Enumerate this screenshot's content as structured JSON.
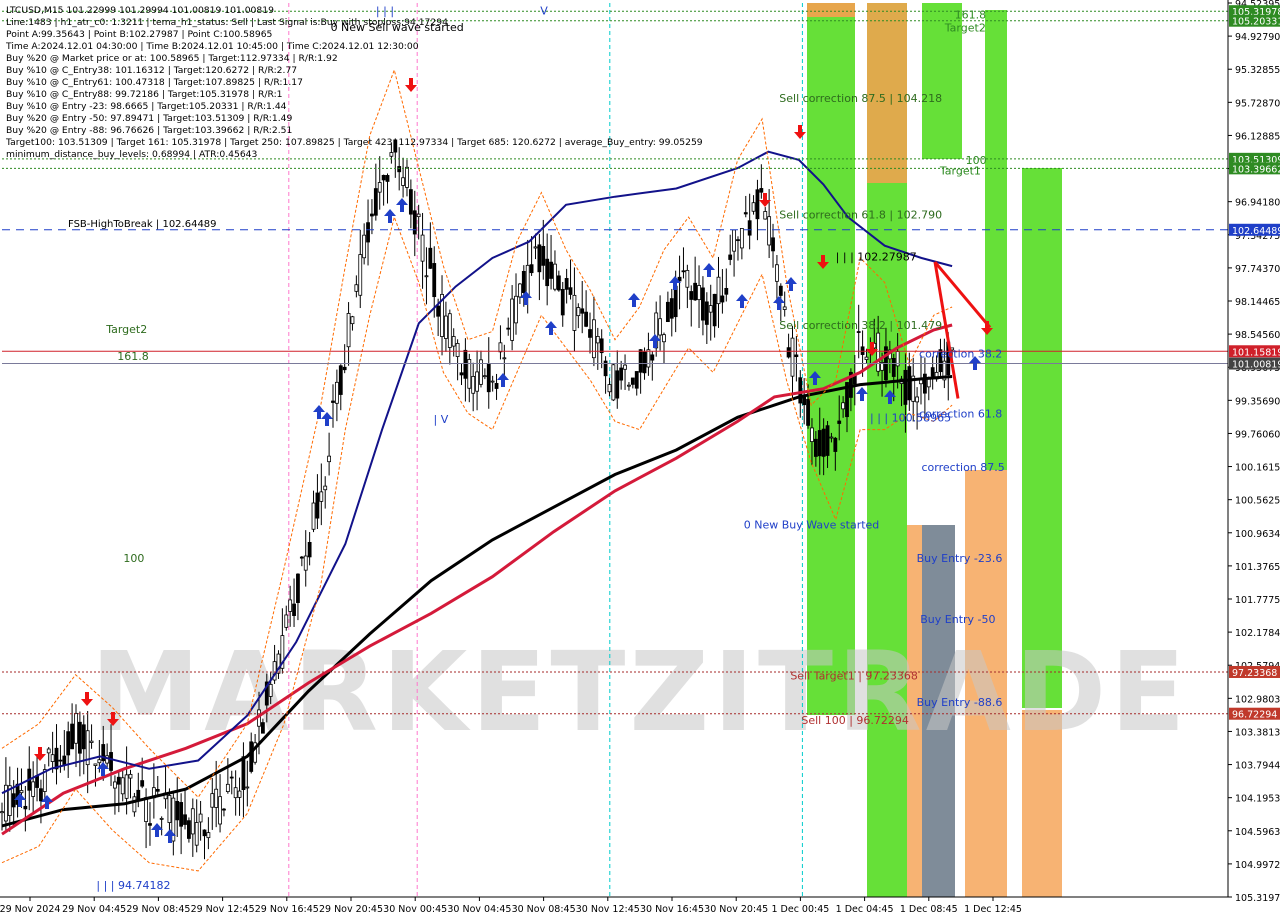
{
  "header": {
    "lines": [
      "LTCUSD,M15  101.22999 101.29994 101.00819 101.00819",
      "Line:1483 | h1_atr_c0: 1.3211 | tema_h1_status: Sell | Last Signal is:Buy with stoploss:94.17294",
      "Point A:99.35643 | Point B:102.27987 | Point C:100.58965",
      "Time A:2024.12.01 04:30:00 | Time B:2024.12.01 10:45:00 | Time C:2024.12.01 12:30:00",
      "Buy %20 @ Market price or at: 100.58965 | Target:112.97334 | R/R:1.92",
      "Buy %10 @ C_Entry38: 101.16312 | Target:120.6272 | R/R:2.77",
      "Buy %10 @ C_Entry61: 100.47318 | Target:107.89825 | R/R:1.17",
      "Buy %10 @ C_Entry88: 99.72186 | Target:105.31978 | R/R:1",
      "Buy %10 @ Entry -23: 98.6665 | Target:105.20331 | R/R:1.44",
      "Buy %20 @ Entry -50: 97.89471 | Target:103.51309 | R/R:1.49",
      "Buy %20 @ Entry -88: 96.76626 | Target:103.39662 | R/R:2.51",
      "Target100: 103.51309 | Target 161: 105.31978 | Target 250: 107.89825 | Target 423: 112.97334 | Target 685: 120.6272 | average_Buy_entry: 99.05259",
      "minimum_distance_buy_levels: 0.68994 | ATR:0.45643"
    ]
  },
  "chart_data": {
    "type": "candlestick",
    "symbol": "LTCUSD",
    "timeframe": "M15",
    "ylim": [
      94.48,
      105.42
    ],
    "x_ticks": [
      "29 Nov 2024",
      "29 Nov 04:45",
      "29 Nov 08:45",
      "29 Nov 12:45",
      "29 Nov 16:45",
      "29 Nov 20:45",
      "30 Nov 00:45",
      "30 Nov 04:45",
      "30 Nov 08:45",
      "30 Nov 12:45",
      "30 Nov 16:45",
      "30 Nov 20:45",
      "1 Dec 00:45",
      "1 Dec 04:45",
      "1 Dec 08:45",
      "1 Dec 12:45"
    ],
    "y_ticks": [
      "94.52395",
      "94.92790",
      "95.32855",
      "95.72870",
      "96.12885",
      "96.52870",
      "96.94180",
      "97.34275",
      "97.74370",
      "98.14465",
      "98.54560",
      "98.95075",
      "99.35690",
      "99.76060",
      "100.16155",
      "100.56250",
      "100.96345",
      "101.37655",
      "101.77750",
      "102.17845",
      "102.57940",
      "102.98035",
      "103.38130",
      "103.79440",
      "104.19535",
      "104.59630",
      "104.99725",
      "105.31978"
    ],
    "price_labels": [
      {
        "text": "105.31978",
        "value": 105.31978,
        "color": "#2e8b22"
      },
      {
        "text": "105.20331",
        "value": 105.20331,
        "color": "#2e8b22"
      },
      {
        "text": "103.51309",
        "value": 103.51309,
        "color": "#2e8b22"
      },
      {
        "text": "103.39662",
        "value": 103.39662,
        "color": "#2e8b22"
      },
      {
        "text": "102.64489",
        "value": 102.64489,
        "color": "#1f3fc8"
      },
      {
        "text": "101.15819",
        "value": 101.15819,
        "color": "#d0202a"
      },
      {
        "text": "101.00819",
        "value": 101.00819,
        "color": "#444444"
      },
      {
        "text": "97.23368",
        "value": 97.23368,
        "color": "#c0392b"
      },
      {
        "text": "96.72294",
        "value": 96.72294,
        "color": "#c0392b"
      }
    ],
    "hlines": [
      {
        "value": 102.64489,
        "color": "#1f3fc8",
        "dash": "8,6",
        "label": "FSB-HighToBreak | 102.64489"
      },
      {
        "value": 101.15819,
        "color": "#d0202a",
        "dash": "",
        "label": ""
      },
      {
        "value": 101.00819,
        "color": "#7a7a9a",
        "dash": "",
        "label": ""
      },
      {
        "value": 103.51309,
        "color": "#2e8b22",
        "dash": "2,2",
        "label": ""
      },
      {
        "value": 103.39662,
        "color": "#2e8b22",
        "dash": "2,2",
        "label": ""
      },
      {
        "value": 105.20331,
        "color": "#2e8b22",
        "dash": "2,2",
        "label": ""
      },
      {
        "value": 105.31978,
        "color": "#2e8b22",
        "dash": "2,2",
        "label": ""
      },
      {
        "value": 97.23368,
        "color": "#a52a2a",
        "dash": "2,2",
        "label": ""
      },
      {
        "value": 96.72294,
        "color": "#a52a2a",
        "dash": "2,2",
        "label": ""
      }
    ],
    "vlines": [
      {
        "tick": 6,
        "color": "#ff77cc"
      },
      {
        "tick": 4,
        "color": "#ff77cc"
      },
      {
        "tick": 9,
        "color": "#00cccc"
      },
      {
        "tick": 12,
        "color": "#00cccc"
      }
    ],
    "annotations": [
      {
        "text": "0 New Sell wave started",
        "value": 105.08,
        "xpos": 0.268,
        "color": "#000000"
      },
      {
        "text": "0 New Buy Wave started",
        "value": 98.99,
        "xpos": 0.605,
        "color": "#1f3fc8"
      },
      {
        "text": "Target2",
        "value": 101.38,
        "xpos": 0.085,
        "color": "#2e6b1e"
      },
      {
        "text": "161.8",
        "value": 101.05,
        "xpos": 0.094,
        "color": "#2e6b1e"
      },
      {
        "text": "100",
        "value": 98.58,
        "xpos": 0.099,
        "color": "#2e6b1e"
      },
      {
        "text": "Sell correction 87.5 | 104.218",
        "value": 104.21,
        "xpos": 0.634,
        "color": "#2e6b1e"
      },
      {
        "text": "Sell correction 61.8 | 102.790",
        "value": 102.78,
        "xpos": 0.634,
        "color": "#2e6b1e"
      },
      {
        "text": "Sell correction 38.2 | 101.479",
        "value": 101.43,
        "xpos": 0.634,
        "color": "#2e6b1e"
      },
      {
        "text": "| | | 102.27987",
        "value": 102.27,
        "xpos": 0.68,
        "color": "#000000"
      },
      {
        "text": "| | | 100.58965",
        "value": 100.3,
        "xpos": 0.708,
        "color": "#1f3fc8"
      },
      {
        "text": "correction 38.2",
        "value": 101.08,
        "xpos": 0.748,
        "color": "#1f3fc8"
      },
      {
        "text": "correction 61.8",
        "value": 100.35,
        "xpos": 0.748,
        "color": "#1f3fc8"
      },
      {
        "text": "correction 87.5",
        "value": 99.69,
        "xpos": 0.75,
        "color": "#1f3fc8"
      },
      {
        "text": "Buy Entry -23.6",
        "value": 98.58,
        "xpos": 0.746,
        "color": "#1f3fc8"
      },
      {
        "text": "Buy Entry -50",
        "value": 97.83,
        "xpos": 0.749,
        "color": "#1f3fc8"
      },
      {
        "text": "Buy Entry -88.6",
        "value": 96.82,
        "xpos": 0.746,
        "color": "#1f3fc8"
      },
      {
        "text": "Sell Target1 | 97.23368",
        "value": 97.14,
        "xpos": 0.643,
        "color": "#b03030"
      },
      {
        "text": "Sell 100 | 96.72294",
        "value": 96.6,
        "xpos": 0.652,
        "color": "#b03030"
      },
      {
        "text": "Target2",
        "value": 105.07,
        "xpos": 0.769,
        "color": "#2e8b22"
      },
      {
        "text": "161.8",
        "value": 105.23,
        "xpos": 0.777,
        "color": "#2e8b22"
      },
      {
        "text": "Target1",
        "value": 103.32,
        "xpos": 0.765,
        "color": "#2e8b22"
      },
      {
        "text": "100",
        "value": 103.45,
        "xpos": 0.786,
        "color": "#2e8b22"
      },
      {
        "text": "| | | 94.74182",
        "value": 94.58,
        "xpos": 0.077,
        "color": "#1f3fc8"
      },
      {
        "text": "| | |",
        "value": 105.28,
        "xpos": 0.305,
        "color": "#1f3fc8"
      },
      {
        "text": "| V",
        "value": 100.28,
        "xpos": 0.352,
        "color": "#1f3fc8"
      },
      {
        "text": "V",
        "value": 105.28,
        "xpos": 0.439,
        "color": "#1f3fc8"
      }
    ],
    "watermark": "MARKETZITRADE",
    "series": [
      {
        "name": "",
        "color": "#000000",
        "width": 3,
        "points": [
          [
            0.0,
            95.35
          ],
          [
            0.05,
            95.55
          ],
          [
            0.1,
            95.62
          ],
          [
            0.15,
            95.8
          ],
          [
            0.2,
            96.2
          ],
          [
            0.25,
            97.0
          ],
          [
            0.3,
            97.7
          ],
          [
            0.35,
            98.35
          ],
          [
            0.4,
            98.85
          ],
          [
            0.45,
            99.25
          ],
          [
            0.5,
            99.65
          ],
          [
            0.55,
            99.95
          ],
          [
            0.6,
            100.35
          ],
          [
            0.65,
            100.6
          ],
          [
            0.7,
            100.75
          ],
          [
            0.75,
            100.82
          ],
          [
            0.775,
            100.85
          ]
        ]
      },
      {
        "name": "",
        "color": "#d41a3a",
        "width": 3,
        "points": [
          [
            0.0,
            95.25
          ],
          [
            0.05,
            95.75
          ],
          [
            0.1,
            96.05
          ],
          [
            0.15,
            96.3
          ],
          [
            0.2,
            96.6
          ],
          [
            0.25,
            97.1
          ],
          [
            0.3,
            97.55
          ],
          [
            0.35,
            97.95
          ],
          [
            0.4,
            98.4
          ],
          [
            0.45,
            98.95
          ],
          [
            0.5,
            99.45
          ],
          [
            0.55,
            99.85
          ],
          [
            0.6,
            100.3
          ],
          [
            0.63,
            100.6
          ],
          [
            0.67,
            100.7
          ],
          [
            0.7,
            100.9
          ],
          [
            0.73,
            101.2
          ],
          [
            0.76,
            101.42
          ],
          [
            0.775,
            101.48
          ]
        ]
      },
      {
        "name": "",
        "color": "#12128a",
        "width": 2,
        "points": [
          [
            0.0,
            95.75
          ],
          [
            0.04,
            96.05
          ],
          [
            0.08,
            96.2
          ],
          [
            0.12,
            96.05
          ],
          [
            0.16,
            96.15
          ],
          [
            0.2,
            96.7
          ],
          [
            0.24,
            97.6
          ],
          [
            0.28,
            98.8
          ],
          [
            0.31,
            100.2
          ],
          [
            0.34,
            101.5
          ],
          [
            0.37,
            101.95
          ],
          [
            0.4,
            102.3
          ],
          [
            0.43,
            102.5
          ],
          [
            0.46,
            102.95
          ],
          [
            0.5,
            103.05
          ],
          [
            0.55,
            103.15
          ],
          [
            0.6,
            103.4
          ],
          [
            0.625,
            103.6
          ],
          [
            0.65,
            103.5
          ],
          [
            0.67,
            103.2
          ],
          [
            0.69,
            102.8
          ],
          [
            0.72,
            102.45
          ],
          [
            0.75,
            102.3
          ],
          [
            0.775,
            102.2
          ]
        ]
      },
      {
        "name": "",
        "color": "#ff6a00",
        "width": 1,
        "dash": "3,2",
        "points": [
          [
            0.0,
            96.3
          ],
          [
            0.03,
            96.6
          ],
          [
            0.06,
            97.2
          ],
          [
            0.09,
            96.8
          ],
          [
            0.12,
            96.3
          ],
          [
            0.16,
            95.7
          ],
          [
            0.2,
            96.6
          ],
          [
            0.23,
            98.5
          ],
          [
            0.26,
            100.5
          ],
          [
            0.28,
            102.2
          ],
          [
            0.3,
            103.8
          ],
          [
            0.32,
            104.6
          ],
          [
            0.34,
            103.4
          ],
          [
            0.36,
            102.2
          ],
          [
            0.38,
            101.3
          ],
          [
            0.4,
            101.4
          ],
          [
            0.42,
            102.5
          ],
          [
            0.44,
            103.1
          ],
          [
            0.46,
            102.4
          ],
          [
            0.48,
            101.9
          ],
          [
            0.5,
            101.3
          ],
          [
            0.52,
            101.7
          ],
          [
            0.54,
            102.4
          ],
          [
            0.56,
            102.8
          ],
          [
            0.58,
            102.3
          ],
          [
            0.6,
            103.5
          ],
          [
            0.62,
            104.0
          ],
          [
            0.64,
            102.0
          ],
          [
            0.66,
            100.5
          ],
          [
            0.68,
            100.8
          ],
          [
            0.7,
            102.3
          ],
          [
            0.72,
            102.0
          ],
          [
            0.74,
            101.0
          ],
          [
            0.76,
            101.6
          ],
          [
            0.775,
            101.7
          ]
        ]
      },
      {
        "name": "",
        "color": "#ff6a00",
        "width": 1,
        "dash": "3,2",
        "points": [
          [
            0.0,
            94.9
          ],
          [
            0.03,
            95.1
          ],
          [
            0.06,
            95.8
          ],
          [
            0.09,
            95.3
          ],
          [
            0.12,
            94.9
          ],
          [
            0.16,
            94.8
          ],
          [
            0.2,
            95.5
          ],
          [
            0.23,
            96.6
          ],
          [
            0.26,
            98.3
          ],
          [
            0.28,
            100.2
          ],
          [
            0.3,
            101.6
          ],
          [
            0.32,
            102.8
          ],
          [
            0.34,
            102.0
          ],
          [
            0.36,
            100.9
          ],
          [
            0.38,
            100.4
          ],
          [
            0.4,
            100.2
          ],
          [
            0.42,
            100.9
          ],
          [
            0.44,
            101.6
          ],
          [
            0.46,
            101.2
          ],
          [
            0.48,
            100.8
          ],
          [
            0.5,
            100.3
          ],
          [
            0.52,
            100.2
          ],
          [
            0.54,
            100.7
          ],
          [
            0.56,
            101.2
          ],
          [
            0.58,
            100.9
          ],
          [
            0.6,
            101.5
          ],
          [
            0.62,
            102.1
          ],
          [
            0.64,
            100.8
          ],
          [
            0.66,
            99.8
          ],
          [
            0.68,
            99.1
          ],
          [
            0.7,
            100.2
          ],
          [
            0.72,
            100.2
          ],
          [
            0.74,
            100.4
          ],
          [
            0.76,
            100.3
          ],
          [
            0.775,
            100.5
          ]
        ]
      }
    ],
    "candles_seed": 1483
  },
  "axis": {
    "last_price": "101.00819"
  }
}
